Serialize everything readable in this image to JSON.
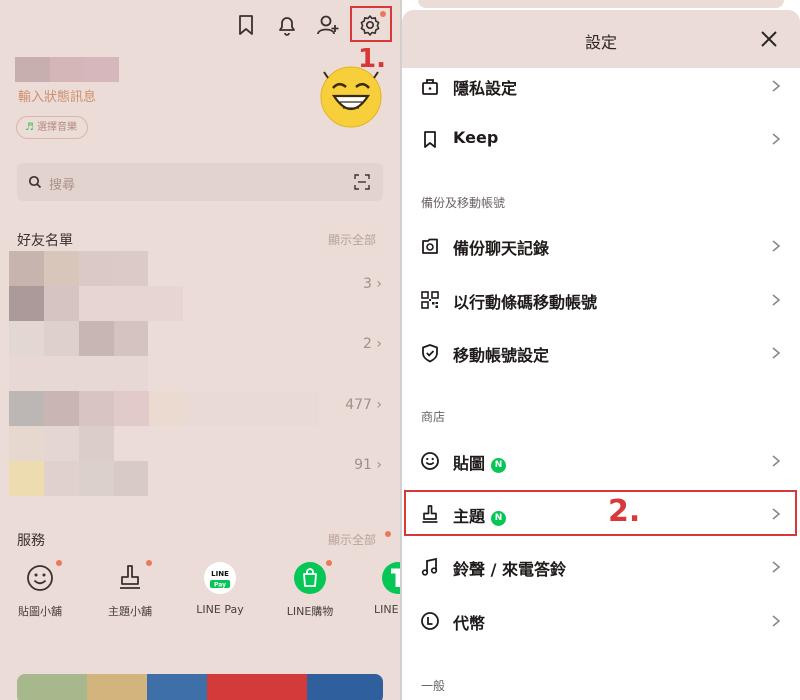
{
  "left": {
    "status_message": "輸入狀態訊息",
    "music_label": "選擇音樂",
    "search_placeholder": "搜尋",
    "friends": {
      "title": "好友名單",
      "show_all": "顯示全部",
      "counts": [
        "3 ›",
        "2 ›",
        "477 ›",
        "91 ›"
      ]
    },
    "services": {
      "title": "服務",
      "show_all": "顯示全部",
      "items": [
        {
          "label": "貼圖小舖",
          "icon": "sticker-shop-icon"
        },
        {
          "label": "主題小舖",
          "icon": "theme-shop-icon"
        },
        {
          "label": "LINE Pay",
          "icon": "line-pay-icon"
        },
        {
          "label": "LINE購物",
          "icon": "line-shopping-icon"
        },
        {
          "label": "LINE",
          "icon": "line-app-icon"
        }
      ]
    },
    "line_pay_badge_top": "LINE",
    "line_pay_badge_bottom": "Pay",
    "annotation_1": "1."
  },
  "right": {
    "title": "設定",
    "rows_top": [
      {
        "label": "隱私設定",
        "icon": "privacy-lock-icon"
      },
      {
        "label": "Keep",
        "icon": "bookmark-icon"
      }
    ],
    "section_backup": "備份及移動帳號",
    "rows_backup": [
      {
        "label": "備份聊天記錄",
        "icon": "backup-icon"
      },
      {
        "label": "以行動條碼移動帳號",
        "icon": "qr-code-icon"
      },
      {
        "label": "移動帳號設定",
        "icon": "shield-check-icon"
      }
    ],
    "section_shop": "商店",
    "rows_shop": [
      {
        "label": "貼圖",
        "icon": "smiley-icon",
        "badge": "N"
      },
      {
        "label": "主題",
        "icon": "brush-icon",
        "badge": "N"
      },
      {
        "label": "鈴聲 / 來電答鈴",
        "icon": "music-note-icon"
      },
      {
        "label": "代幣",
        "icon": "coin-icon"
      }
    ],
    "section_general": "一般",
    "annotation_2": "2."
  },
  "colors": {
    "accent_red": "#d93838",
    "line_green": "#06c755",
    "panel_bg": "#ebdcd8",
    "notification_dot": "#e8795a"
  }
}
